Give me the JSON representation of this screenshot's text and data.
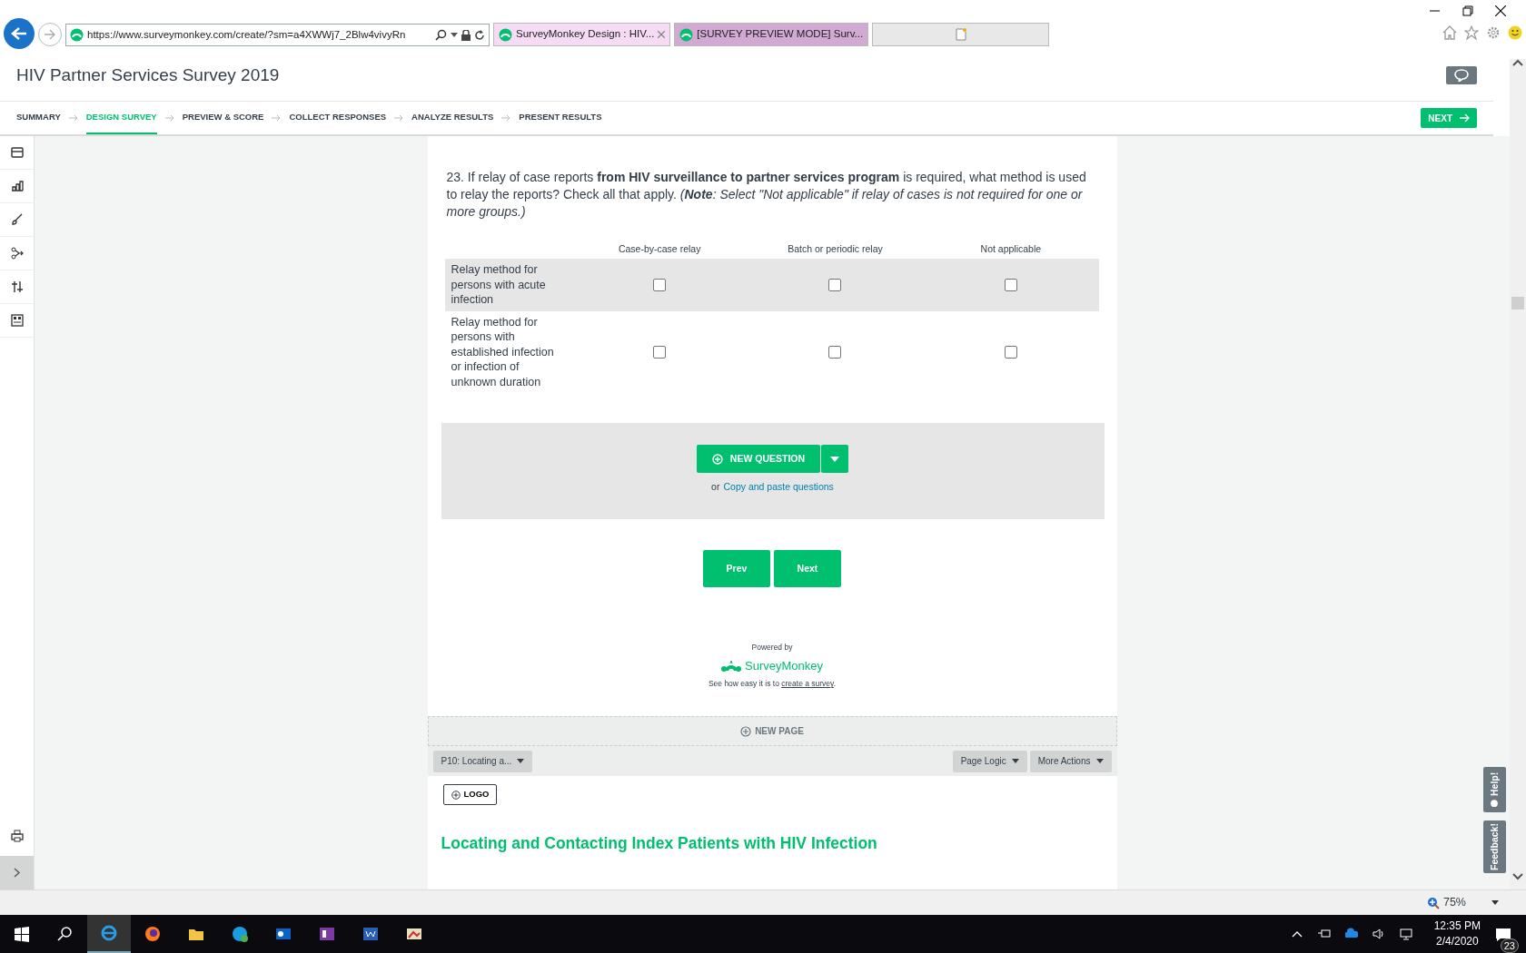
{
  "browser": {
    "address": "https://www.surveymonkey.com/create/?sm=a4XWWj7_2Blw4vivyRn",
    "tabs": [
      {
        "title": "SurveyMonkey Design : HIV...",
        "selected": true
      },
      {
        "title": "[SURVEY PREVIEW MODE] Surv...",
        "selected": false
      }
    ]
  },
  "survey_title": "HIV Partner Services Survey 2019",
  "steps": [
    {
      "label": "SUMMARY",
      "selected": false
    },
    {
      "label": "DESIGN SURVEY",
      "selected": true
    },
    {
      "label": "PREVIEW & SCORE",
      "selected": false
    },
    {
      "label": "COLLECT RESPONSES",
      "selected": false
    },
    {
      "label": "ANALYZE RESULTS",
      "selected": false
    },
    {
      "label": "PRESENT RESULTS",
      "selected": false
    }
  ],
  "next_button": "NEXT",
  "question": {
    "text": "23. If relay of case reports  **from HIV surveillance to partner services program**  is required, what method is used to relay the reports? Check all that apply.",
    "note": "(**Note**: Select \"Not applicable\" if relay of cases is not required for one or more groups.)",
    "columns": [
      "Case-by-case relay",
      "Batch or periodic relay",
      "Not applicable"
    ],
    "rows": [
      {
        "label": "Relay method for persons with acute infection",
        "highlighted": true,
        "cells": [
          {
            "checked": false
          },
          {
            "checked": false
          },
          {
            "checked": false
          }
        ]
      },
      {
        "label": "Relay method for persons with established infection or infection of unknown duration",
        "highlighted": false,
        "cells": [
          {
            "checked": false
          },
          {
            "checked": false
          },
          {
            "checked": false
          }
        ]
      }
    ]
  },
  "new_question": {
    "label": "NEW QUESTION",
    "prefix": "or",
    "link": "Copy and paste questions"
  },
  "page_buttons": [
    "Prev",
    "Next"
  ],
  "footer": {
    "powered_by": "Powered by",
    "brand": "SurveyMonkey",
    "tagline": "See how easy it is to **create a survey**."
  },
  "new_page": "NEW PAGE",
  "page_bar": {
    "page_menu": "P10: Locating a...",
    "actions": [
      "Page Logic",
      "More Actions"
    ]
  },
  "logo_button": "LOGO",
  "page_title": "Locating and Contacting Index Patients with HIV Infection",
  "side_tabs": [
    "Help!",
    "Feedback!"
  ],
  "status_bar": {
    "zoom": "75%"
  },
  "taskbar": {
    "time": "12:35 PM",
    "date": "2/4/2020",
    "notifications": "23"
  }
}
